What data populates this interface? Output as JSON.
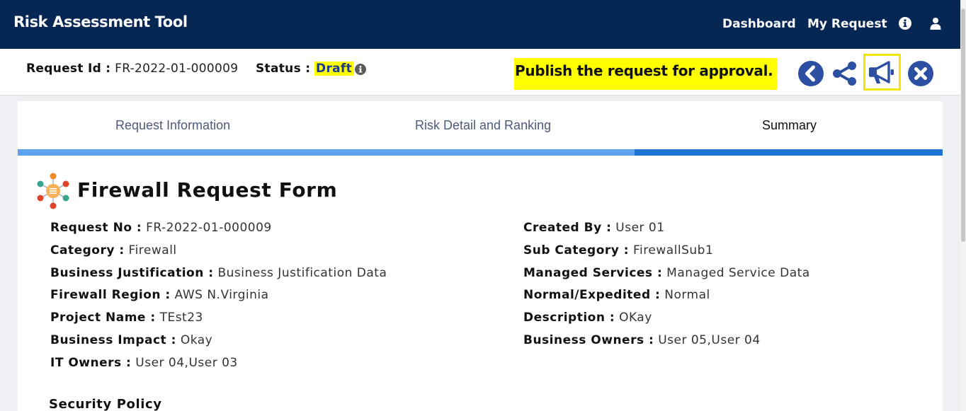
{
  "app": {
    "title": "Risk Assessment Tool"
  },
  "nav": {
    "dashboard": "Dashboard",
    "my_request": "My Request"
  },
  "request": {
    "id_label": "Request Id :",
    "id_value": "FR-2022-01-000009",
    "status_label": "Status :",
    "status_value": "Draft",
    "tooltip": "Publish the request for approval."
  },
  "tabs": [
    {
      "label": "Request Information"
    },
    {
      "label": "Risk Detail and Ranking"
    },
    {
      "label": "Summary"
    }
  ],
  "form": {
    "title": "Firewall Request Form",
    "left_fields": [
      {
        "label": "Request No :",
        "value": "FR-2022-01-000009"
      },
      {
        "label": "Category :",
        "value": "Firewall"
      },
      {
        "label": "Business Justification :",
        "value": "Business Justification Data"
      },
      {
        "label": "Firewall Region :",
        "value": "AWS N.Virginia"
      },
      {
        "label": "Project Name :",
        "value": "TEst23"
      },
      {
        "label": "Business Impact :",
        "value": "Okay"
      },
      {
        "label": "IT Owners :",
        "value": "User 04,User 03"
      }
    ],
    "right_fields": [
      {
        "label": "Created By :",
        "value": "User 01"
      },
      {
        "label": "Sub Category :",
        "value": "FirewallSub1"
      },
      {
        "label": "Managed Services :",
        "value": "Managed Service Data"
      },
      {
        "label": "Normal/Expedited :",
        "value": "Normal"
      },
      {
        "label": "Description :",
        "value": "OKay"
      },
      {
        "label": "Business Owners :",
        "value": "User 05,User 04"
      }
    ],
    "section_title": "Security Policy"
  },
  "colors": {
    "header_bg": "#062654",
    "tab_active": "#1e72d2",
    "tab_inactive": "#5ba3ec",
    "highlight": "#ffff00",
    "icon_blue": "#2c4fa3"
  },
  "icons": {
    "info": "info-icon",
    "user": "user-icon",
    "back": "back-icon",
    "share": "share-icon",
    "publish": "megaphone-icon",
    "close": "close-icon"
  }
}
